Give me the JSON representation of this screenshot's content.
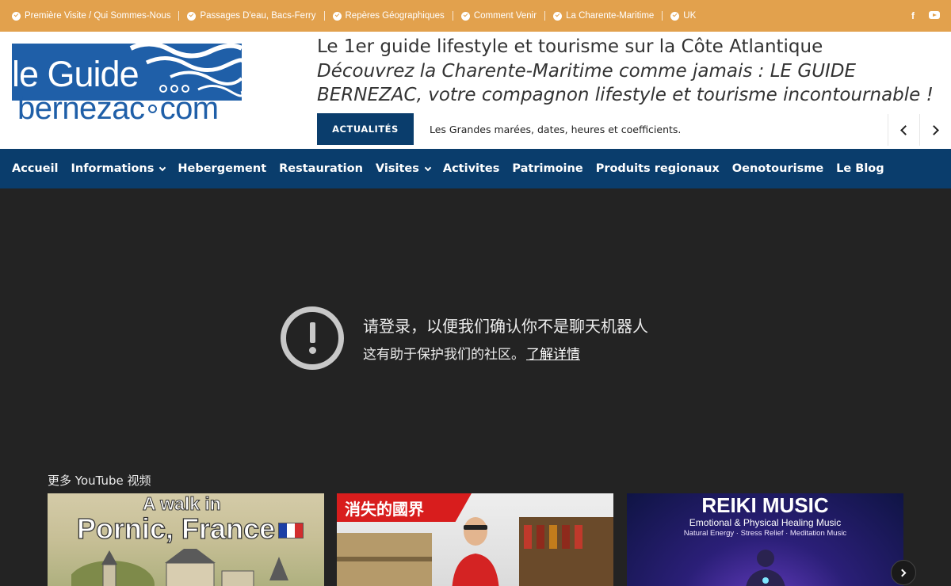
{
  "topbar": {
    "links": [
      {
        "label": "Première Visite / Qui Sommes-Nous"
      },
      {
        "label": "Passages D'eau, Bacs-Ferry"
      },
      {
        "label": "Repères Géographiques"
      },
      {
        "label": "Comment Venir"
      },
      {
        "label": "La Charente-Maritime"
      },
      {
        "label": "UK"
      }
    ],
    "social": [
      "facebook-icon",
      "youtube-icon"
    ],
    "facebook_glyph": "f",
    "bg_color": "#e2a14d"
  },
  "logo": {
    "line1": "le Guide",
    "line2a": "bernezac",
    "line2b": "com",
    "color": "#1f5fa8"
  },
  "header": {
    "tagline": "Le 1er guide lifestyle et tourisme sur la Côte Atlantique",
    "subtagline": "Découvrez la Charente-Maritime comme jamais : LE GUIDE BERNEZAC, votre compagnon lifestyle et tourisme incontournable !"
  },
  "news": {
    "badge": "ACTUALITÉS",
    "headline": "Les Grandes marées, dates, heures et coefficients."
  },
  "nav": {
    "items": [
      {
        "label": "Accueil"
      },
      {
        "label": "Informations"
      },
      {
        "label": "Hebergement"
      },
      {
        "label": "Restauration"
      },
      {
        "label": "Visites"
      },
      {
        "label": "Activites"
      },
      {
        "label": "Patrimoine"
      },
      {
        "label": "Produits regionaux"
      },
      {
        "label": "Oenotourisme"
      },
      {
        "label": "Le Blog"
      }
    ],
    "bg_color": "#0a3d6c"
  },
  "embed": {
    "title": "请登录，以便我们确认你不是聊天机器人",
    "subtitle": "这有助于保护我们的社区。",
    "link": "了解详情",
    "more_videos": "更多 YouTube 视频",
    "videos": [
      {
        "line1": "A walk in",
        "line2": "Pornic, France"
      },
      {
        "tag": "消失的國界"
      },
      {
        "line1": "REIKI MUSIC",
        "line2": "Emotional & Physical Healing Music",
        "line3": "Natural Energy · Stress Relief · Meditation Music"
      }
    ]
  }
}
